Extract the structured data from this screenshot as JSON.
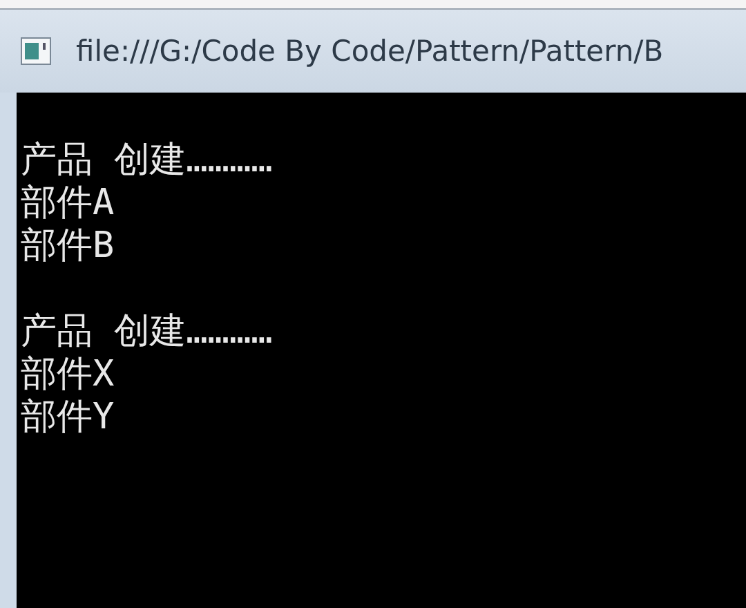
{
  "window": {
    "title": "file:///G:/Code By Code/Pattern/Pattern/B"
  },
  "console": {
    "blocks": [
      {
        "heading": "产品 创建…………",
        "lines": [
          "部件A",
          "部件B"
        ]
      },
      {
        "heading": "产品 创建…………",
        "lines": [
          "部件X",
          "部件Y"
        ]
      }
    ]
  }
}
